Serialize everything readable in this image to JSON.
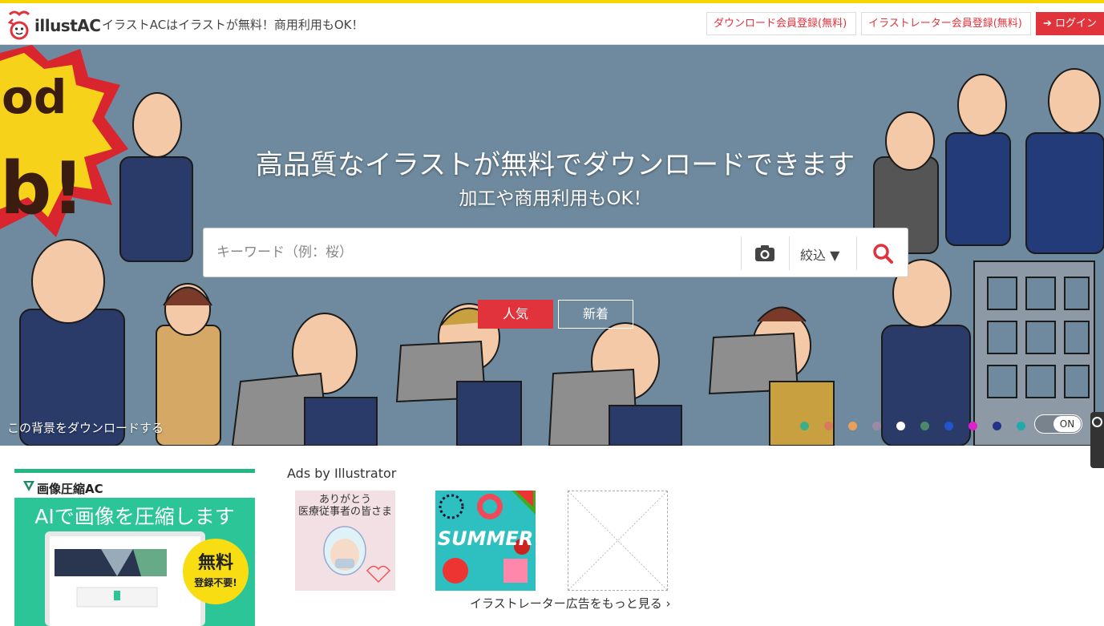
{
  "header": {
    "brand": "illustAC",
    "tagline": "イラストACはイラストが無料！商用利用もOK！",
    "download_signup": "ダウンロード会員登録(無料)",
    "illustrator_signup": "イラストレーター会員登録(無料)",
    "login": "ログイン"
  },
  "hero": {
    "title": "高品質なイラストが無料でダウンロードできます",
    "subtitle": "加工や商用利用もOK！",
    "search_placeholder": "キーワード（例：桜）",
    "filter_label": "絞込 ▼",
    "tabs": [
      {
        "label": "人気",
        "active": true
      },
      {
        "label": "新着",
        "active": false
      }
    ],
    "bg_download": "この背景をダウンロードする",
    "toggle": "ON",
    "dot_colors": [
      "#3dae8a",
      "#d97a5a",
      "#e8a05a",
      "#9a8aa8",
      "#ffffff",
      "#4a8a6a",
      "#2255cc",
      "#dd22cc",
      "#223388",
      "#22aaaa"
    ],
    "background_art": "good-job-business-people-illustration"
  },
  "ad": {
    "brand": "画像圧縮AC",
    "headline": "AIで画像を圧縮します",
    "badge_big": "無料",
    "badge_small": "登録不要!"
  },
  "illustrator_ads": {
    "title": "Ads by Illustrator",
    "item1_text": "ありがとう\n医療従事者の皆さま",
    "item2_text": "SUMMER",
    "more_link": "イラストレーター広告をもっと見る ›"
  },
  "colors": {
    "accent": "#e0333c",
    "topbar": "#f7d600",
    "hero_bg": "#6f8a9e"
  }
}
